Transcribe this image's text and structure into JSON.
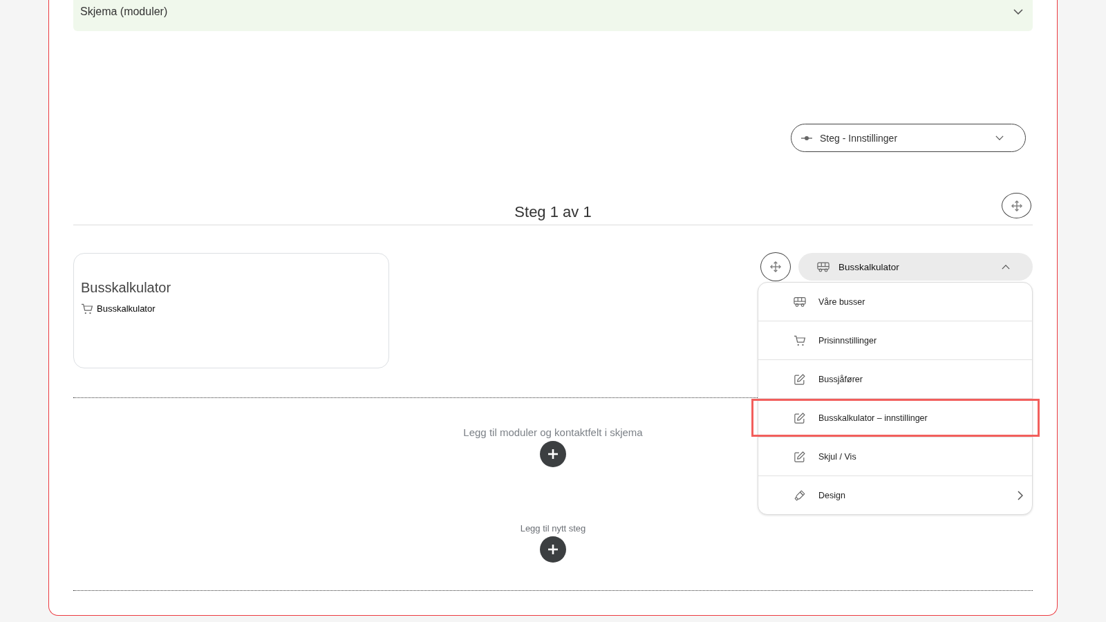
{
  "section": {
    "title": "Skjema (moduler)"
  },
  "step_settings": {
    "label": "Steg - Innstillinger"
  },
  "step": {
    "heading": "Steg 1 av 1"
  },
  "module_card": {
    "title": "Busskalkulator",
    "items": [
      {
        "label": "Busskalkulator"
      }
    ]
  },
  "module_menu": {
    "label": "Busskalkulator",
    "expanded": true,
    "items": [
      {
        "label": "Våre busser",
        "kind": "vehicles",
        "highlighted": false
      },
      {
        "label": "Prisinnstillinger",
        "kind": "pricing",
        "highlighted": false
      },
      {
        "label": "Bussjåfører",
        "kind": "form",
        "highlighted": false
      },
      {
        "label": "Busskalkulator – innstillinger",
        "kind": "form",
        "highlighted": true
      },
      {
        "label": "Skjul / Vis",
        "kind": "form",
        "highlighted": false
      },
      {
        "label": "Design",
        "kind": "submenu",
        "highlighted": false
      }
    ]
  },
  "add_module": {
    "label": "Legg til moduler og kontaktfelt i skjema"
  },
  "add_step": {
    "label": "Legg til nytt steg"
  }
}
